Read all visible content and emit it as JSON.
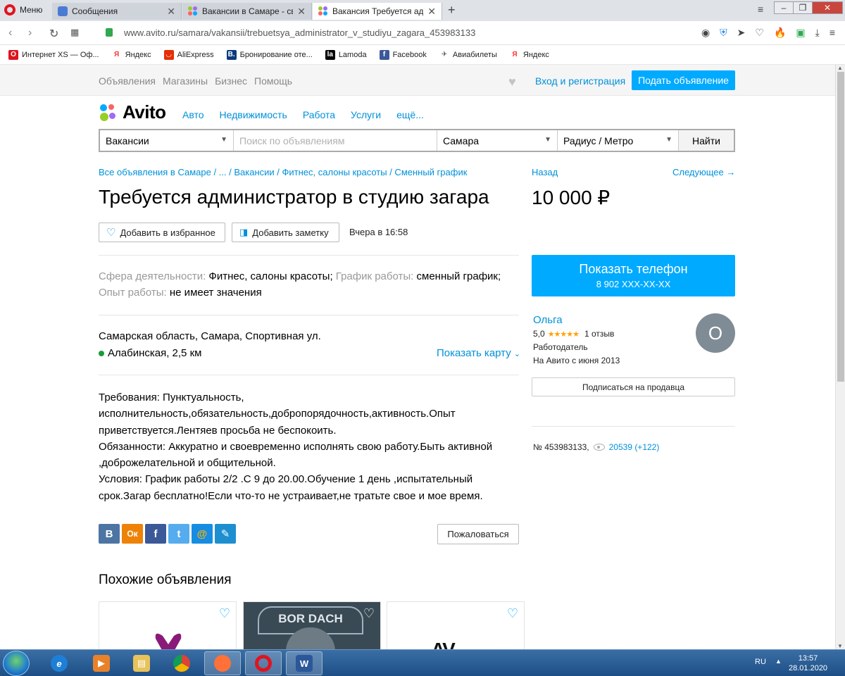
{
  "browser": {
    "menu_label": "Меню",
    "tabs": [
      {
        "title": "Сообщения",
        "close": "✕"
      },
      {
        "title": "Вакансии в Самаре - свеж",
        "close": "✕"
      },
      {
        "title": "Вакансия Требуется адми",
        "close": "✕"
      }
    ],
    "new_tab": "+",
    "url": "www.avito.ru/samara/vakansii/trebuetsya_administrator_v_studiyu_zagara_453983133",
    "bookmarks": [
      {
        "label": "Интернет XS — Оф...",
        "icon": "opera-icon",
        "color": "#e0141e"
      },
      {
        "label": "Яндекс",
        "icon": "yandex-icon",
        "color": "#ff3333"
      },
      {
        "label": "AliExpress",
        "icon": "aliexpress-icon",
        "color": "#e62e04"
      },
      {
        "label": "Бронирование оте...",
        "icon": "booking-icon",
        "color": "#0c3b7c"
      },
      {
        "label": "Lamoda",
        "icon": "lamoda-icon",
        "color": "#000000"
      },
      {
        "label": "Facebook",
        "icon": "facebook-icon",
        "color": "#3b5998"
      },
      {
        "label": "Авиабилеты",
        "icon": "plane-icon",
        "color": "#555555"
      },
      {
        "label": "Яндекс",
        "icon": "yandex-icon",
        "color": "#ff3333"
      }
    ]
  },
  "topnav": {
    "links": [
      "Объявления",
      "Магазины",
      "Бизнес",
      "Помощь"
    ],
    "login": "Вход и регистрация",
    "post_button": "Подать объявление"
  },
  "header": {
    "logo": "Avito",
    "categories": [
      "Авто",
      "Недвижимость",
      "Работа",
      "Услуги",
      "ещё..."
    ]
  },
  "search": {
    "category": "Вакансии",
    "placeholder": "Поиск по объявлениям",
    "city": "Самара",
    "radius": "Радиус / Метро",
    "find": "Найти"
  },
  "ad": {
    "breadcrumbs": "Все объявления в Самаре / ... / Вакансии / Фитнес, салоны красоты / Сменный график",
    "title": "Требуется администратор в студию загара",
    "add_favorite": "Добавить в избранное",
    "add_note": "Добавить заметку",
    "date": "Вчера в 16:58",
    "params": [
      {
        "key": "Сфера деятельности:",
        "value": "Фитнес, салоны красоты;"
      },
      {
        "key": "График работы:",
        "value": "сменный график;"
      },
      {
        "key": "Опыт работы:",
        "value": "не имеет значения"
      }
    ],
    "address": "Самарская область, Самара, Спортивная ул.",
    "metro": "Алабинская, 2,5 км",
    "show_map": "Показать карту",
    "description": [
      "Требования: Пунктуальность, исполнительность,обязательность,добропорядочность,активность.Опыт приветствуется.Лентяев просьба не беспокоить.",
      "Обязанности: Аккуратно и своевременно исполнять свою работу.Быть активной ,доброжелательной и общительной.",
      "Условия: График работы 2/2 .С 9 до 20.00.Обучение 1 день ,испытательный срок.Загар бесплатно!Если что-то не устраивает,не тратьте свое и мое время."
    ],
    "share": [
      {
        "label": "В",
        "icon": "vk-icon",
        "color": "#4c75a3"
      },
      {
        "label": "Ок",
        "icon": "odnoklassniki-icon",
        "color": "#ee8208"
      },
      {
        "label": "f",
        "icon": "facebook-icon",
        "color": "#3b5998"
      },
      {
        "label": "t",
        "icon": "twitter-icon",
        "color": "#55acee"
      },
      {
        "label": "@",
        "icon": "mailru-icon",
        "color": "#168de2"
      },
      {
        "label": "✎",
        "icon": "livejournal-icon",
        "color": "#1d8fd0"
      }
    ],
    "report": "Пожаловаться",
    "similar_title": "Похожие объявления",
    "similar_cards": [
      {
        "text": "",
        "bg": "#ffffff"
      },
      {
        "text": "BOR DACH",
        "bg": "#3a4a55"
      },
      {
        "text": "AV",
        "bg": "#ffffff"
      }
    ]
  },
  "sidebar": {
    "back": "Назад",
    "next": "Следующее →",
    "price": "10 000 ₽",
    "phone_title": "Показать телефон",
    "phone_number": "8 902 XXX-XX-XX",
    "seller_name": "Ольга",
    "rating": "5,0",
    "stars": "★★★★★",
    "reviews": "1 отзыв",
    "seller_type": "Работодатель",
    "seller_since": "На Авито с июня 2013",
    "avatar_letter": "О",
    "subscribe": "Подписаться на продавца",
    "ad_number": "№ 453983133,",
    "views": "20539 (+122)"
  },
  "taskbar": {
    "lang": "RU",
    "time": "13:57",
    "date": "28.01.2020"
  }
}
